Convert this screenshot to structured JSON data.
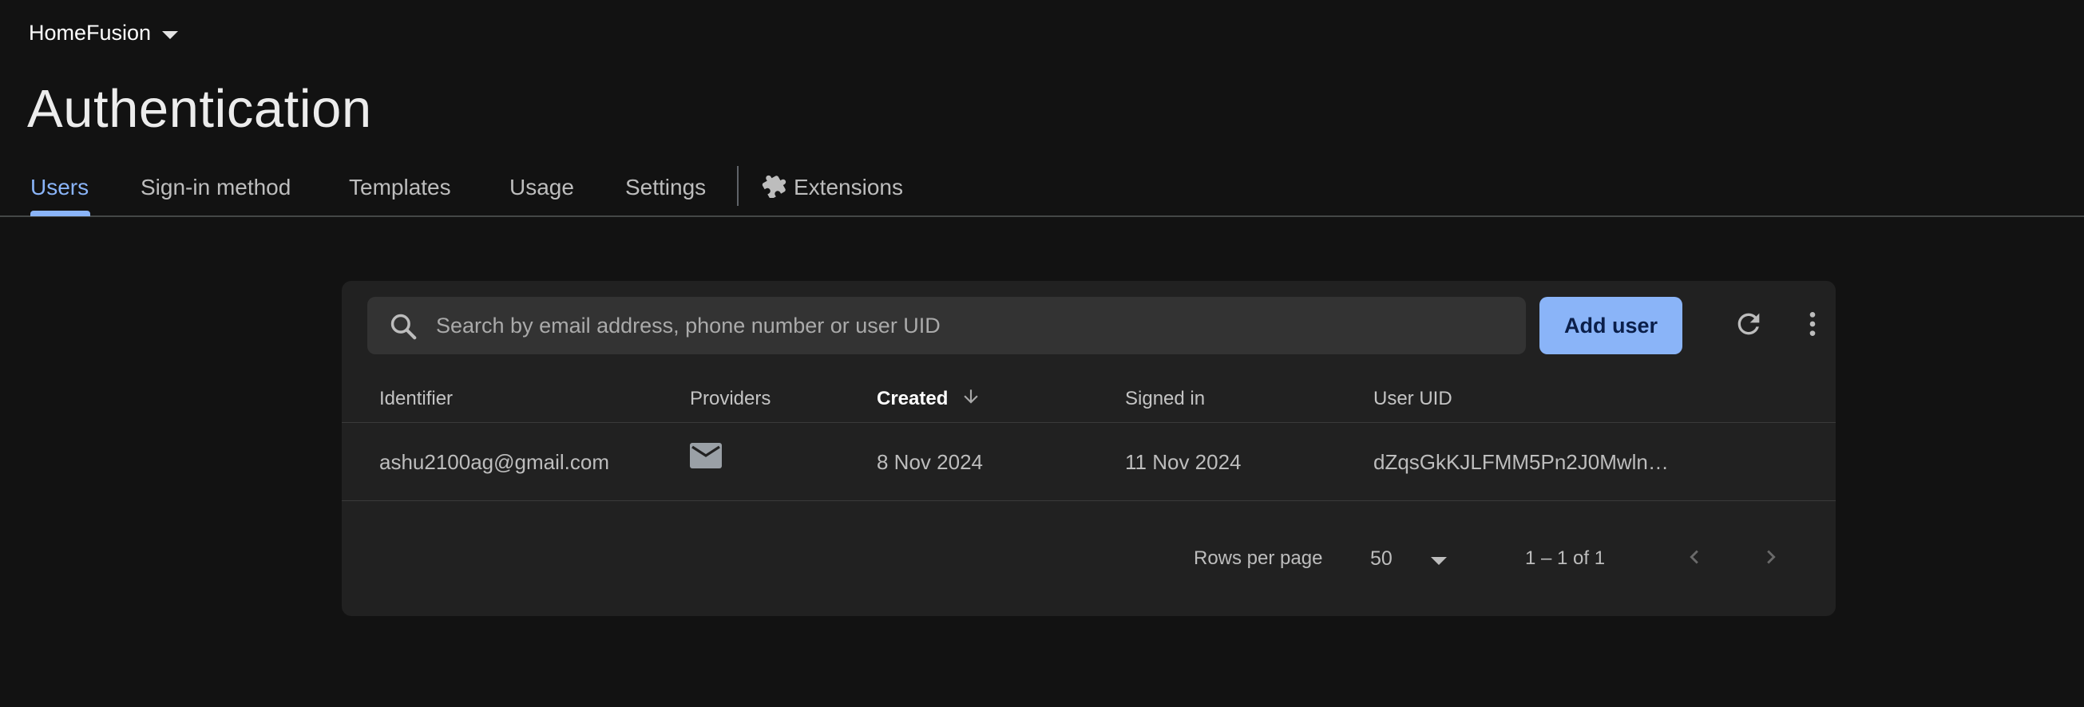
{
  "project": {
    "name": "HomeFusion"
  },
  "page": {
    "title": "Authentication"
  },
  "tabs": [
    {
      "label": "Users",
      "active": true
    },
    {
      "label": "Sign-in method",
      "active": false
    },
    {
      "label": "Templates",
      "active": false
    },
    {
      "label": "Usage",
      "active": false
    },
    {
      "label": "Settings",
      "active": false
    },
    {
      "label": "Extensions",
      "active": false,
      "icon": "puzzle-icon"
    }
  ],
  "toolbar": {
    "search_placeholder": "Search by email address, phone number or user UID",
    "search_value": "",
    "add_user_label": "Add user",
    "refresh_icon": "refresh-icon",
    "more_icon": "more-vert-icon"
  },
  "table": {
    "columns": {
      "identifier": "Identifier",
      "providers": "Providers",
      "created": "Created",
      "signed_in": "Signed in",
      "user_uid": "User UID"
    },
    "sort": {
      "column": "created",
      "direction": "descending"
    },
    "rows": [
      {
        "identifier": "ashu2100ag@gmail.com",
        "provider_icon": "email-icon",
        "created": "8 Nov 2024",
        "signed_in": "11 Nov 2024",
        "user_uid": "dZqsGkKJLFMM5Pn2J0Mwln…"
      }
    ]
  },
  "pagination": {
    "rows_per_page_label": "Rows per page",
    "rows_per_page_value": "50",
    "range_text": "1 – 1 of 1"
  },
  "colors": {
    "background": "#121212",
    "card": "#212121",
    "accent": "#8ab4f8",
    "search_bg": "#333333"
  }
}
